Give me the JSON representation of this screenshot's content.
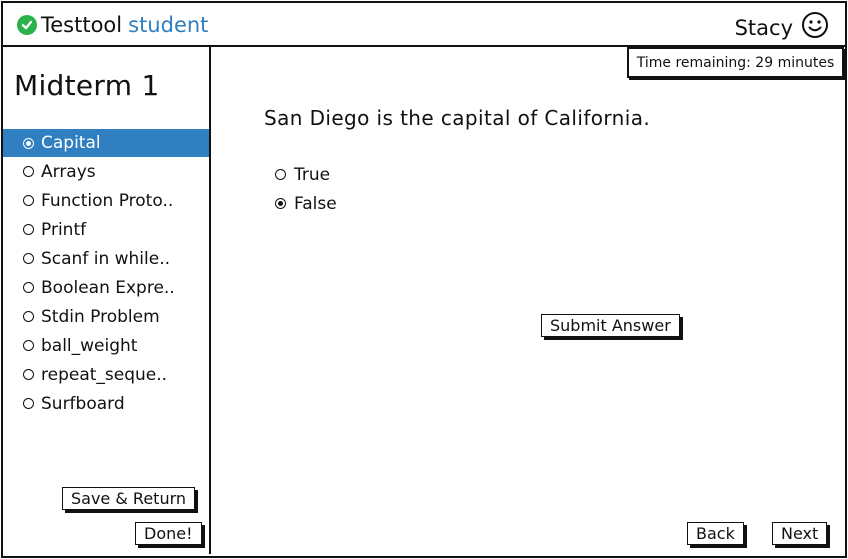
{
  "header": {
    "brand_name": "Testtool",
    "brand_accent": "student",
    "user_name": "Stacy"
  },
  "sidebar": {
    "exam_title": "Midterm 1",
    "questions": [
      {
        "label": "Capital",
        "selected": true
      },
      {
        "label": "Arrays",
        "selected": false
      },
      {
        "label": "Function Proto..",
        "selected": false
      },
      {
        "label": "Printf",
        "selected": false
      },
      {
        "label": "Scanf in while..",
        "selected": false
      },
      {
        "label": "Boolean Expre..",
        "selected": false
      },
      {
        "label": "Stdin Problem",
        "selected": false
      },
      {
        "label": "ball_weight",
        "selected": false
      },
      {
        "label": "repeat_seque..",
        "selected": false
      },
      {
        "label": "Surfboard",
        "selected": false
      }
    ],
    "save_return_label": "Save & Return",
    "done_label": "Done!"
  },
  "main": {
    "timer_text": "Time remaining: 29 minutes",
    "question_text": "San Diego is the capital of California.",
    "options": [
      {
        "label": "True",
        "selected": false
      },
      {
        "label": "False",
        "selected": true
      }
    ],
    "submit_label": "Submit Answer",
    "back_label": "Back",
    "next_label": "Next"
  },
  "colors": {
    "accent": "#2f7fc1",
    "check": "#2bb24c",
    "ink": "#111111"
  },
  "icons": [
    "check-circle-icon",
    "smiley-icon",
    "radio-icon"
  ]
}
